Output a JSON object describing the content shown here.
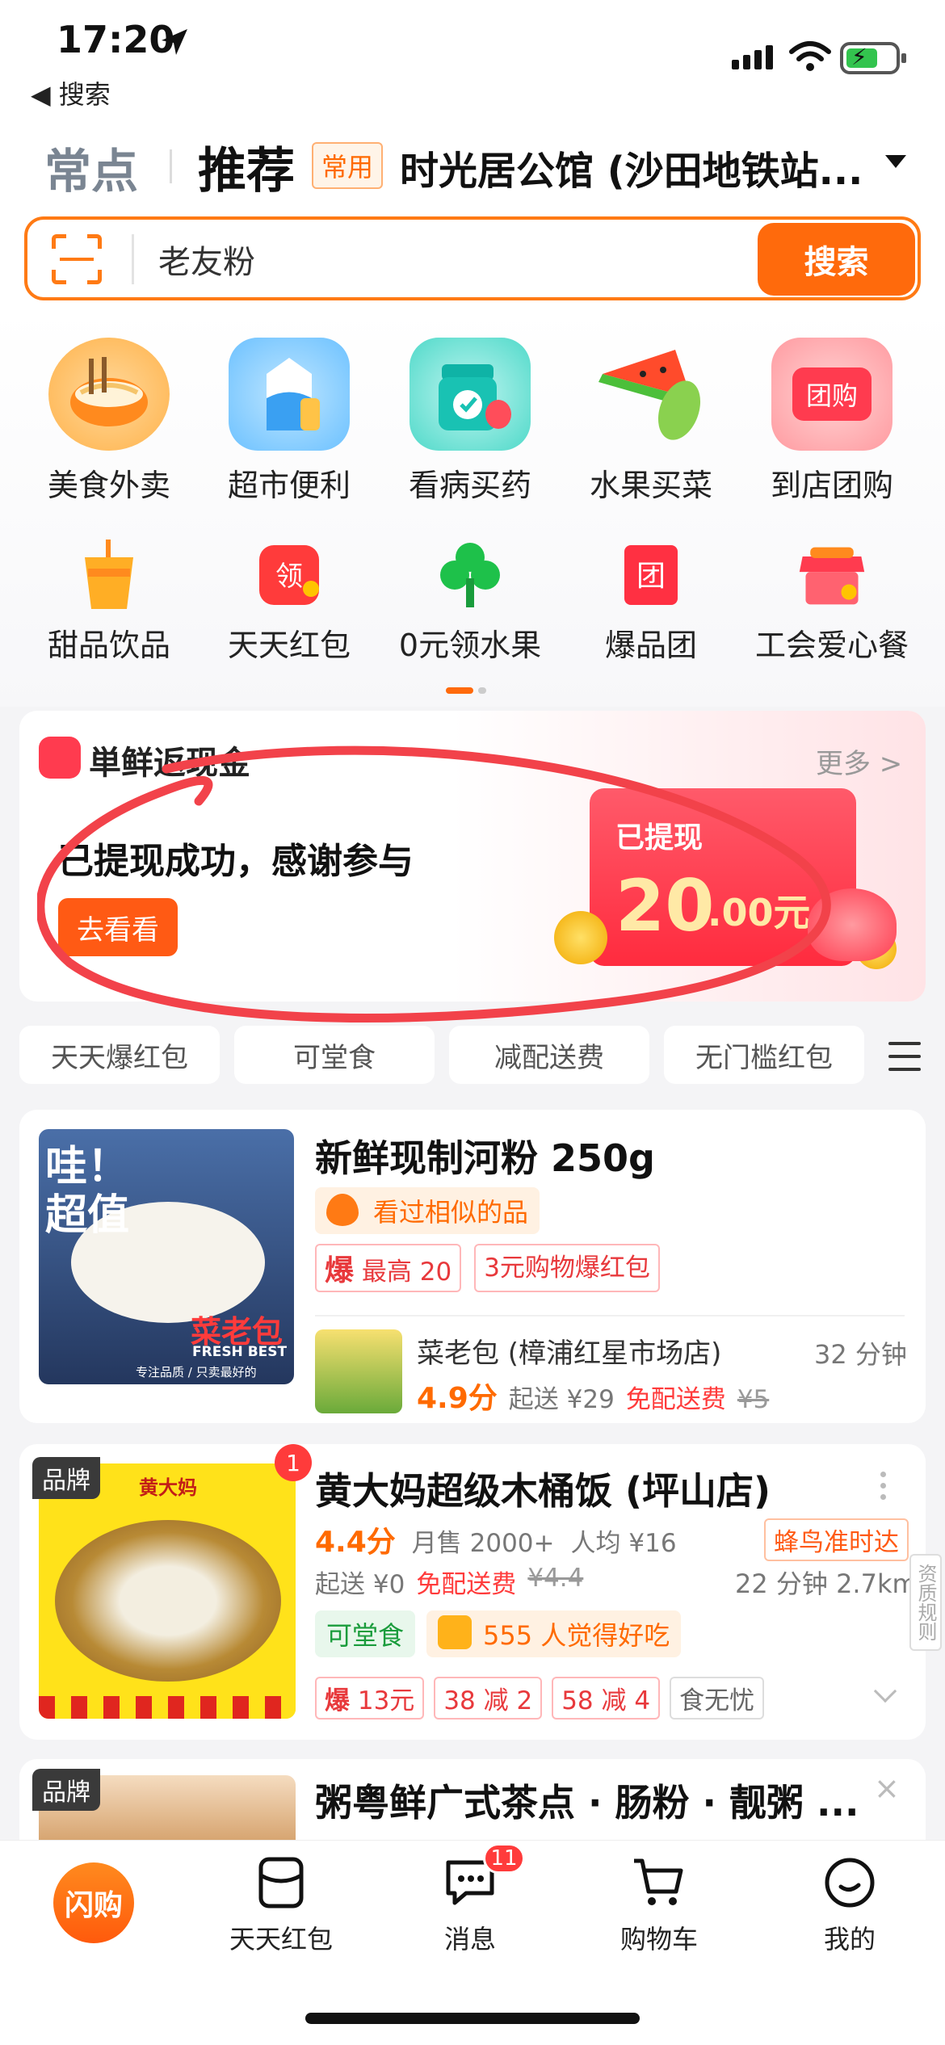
{
  "status": {
    "time": "17:20",
    "back_label": "◀ 搜索"
  },
  "header": {
    "tab_common": "常点",
    "tab_recommend": "推荐",
    "address_tag": "常用",
    "address": "时光居公馆 (沙田地铁站..."
  },
  "search": {
    "query": "老友粉",
    "button": "搜索"
  },
  "categories_row1": [
    "美食外卖",
    "超市便利",
    "看病买药",
    "水果买菜",
    "到店团购"
  ],
  "categories_row2": [
    "甜品饮品",
    "天天红包",
    "0元领水果",
    "爆品团",
    "工会爱心餐"
  ],
  "promo": {
    "title": "単鲜返现金",
    "more": "更多 >",
    "message": "已提现成功，感谢参与",
    "button": "去看看",
    "box_label": "已提现",
    "amount": "20",
    "amount_unit": ".00元"
  },
  "chips": [
    "天天爆红包",
    "可堂食",
    "减配送费",
    "无门槛红包"
  ],
  "product": {
    "title": "新鲜现制河粉 250g",
    "similar": "看过相似的品",
    "burst_label": "爆",
    "burst_max": "最高 20",
    "coupon": "3元购物爆红包",
    "thumb_text1": "哇！",
    "thumb_text2": "超值",
    "thumb_brand": "菜老包",
    "thumb_fresh": "FRESH BEST",
    "thumb_slogan": "专注品质 / 只卖最好的",
    "store_name": "菜老包 (樟浦红星市场店)",
    "store_time": "32 分钟",
    "rating": "4.9分",
    "min_order": "起送 ¥29",
    "free_delivery": "免配送费",
    "old_fee": "¥5"
  },
  "restaurant": {
    "brand_tag": "品牌",
    "badge_count": "1",
    "name": "黄大妈超级木桶饭 (坪山店)",
    "rating": "4.4分",
    "monthly_sales": "月售 2000+",
    "per_person": "人均 ¥16",
    "delivery_tag": "蜂鸟准时达",
    "min_order": "起送 ¥0",
    "free_delivery": "免配送费",
    "old_fee": "¥4.4",
    "eta": "22 分钟 2.7km",
    "dine_in": "可堂食",
    "likes": "555 人觉得好吃",
    "burst_label": "爆",
    "burst_amount": "13元",
    "promo1": "38 减 2",
    "promo2": "58 减 4",
    "promo3": "食无忧",
    "side_label": "资质规则",
    "thumb_logo": "黄大妈"
  },
  "restaurant2": {
    "brand_tag": "品牌",
    "name": "粥粤鲜广式茶点 · 肠粉 · 靓粥 ..."
  },
  "bottom_nav": {
    "home": "闪购",
    "hongbao": "天天红包",
    "messages": "消息",
    "messages_badge": "11",
    "cart": "购物车",
    "me": "我的"
  },
  "colors": {
    "accent": "#ff6a0c",
    "promo_red": "#ff2b3e",
    "annotation_circle": "#f2424a"
  }
}
